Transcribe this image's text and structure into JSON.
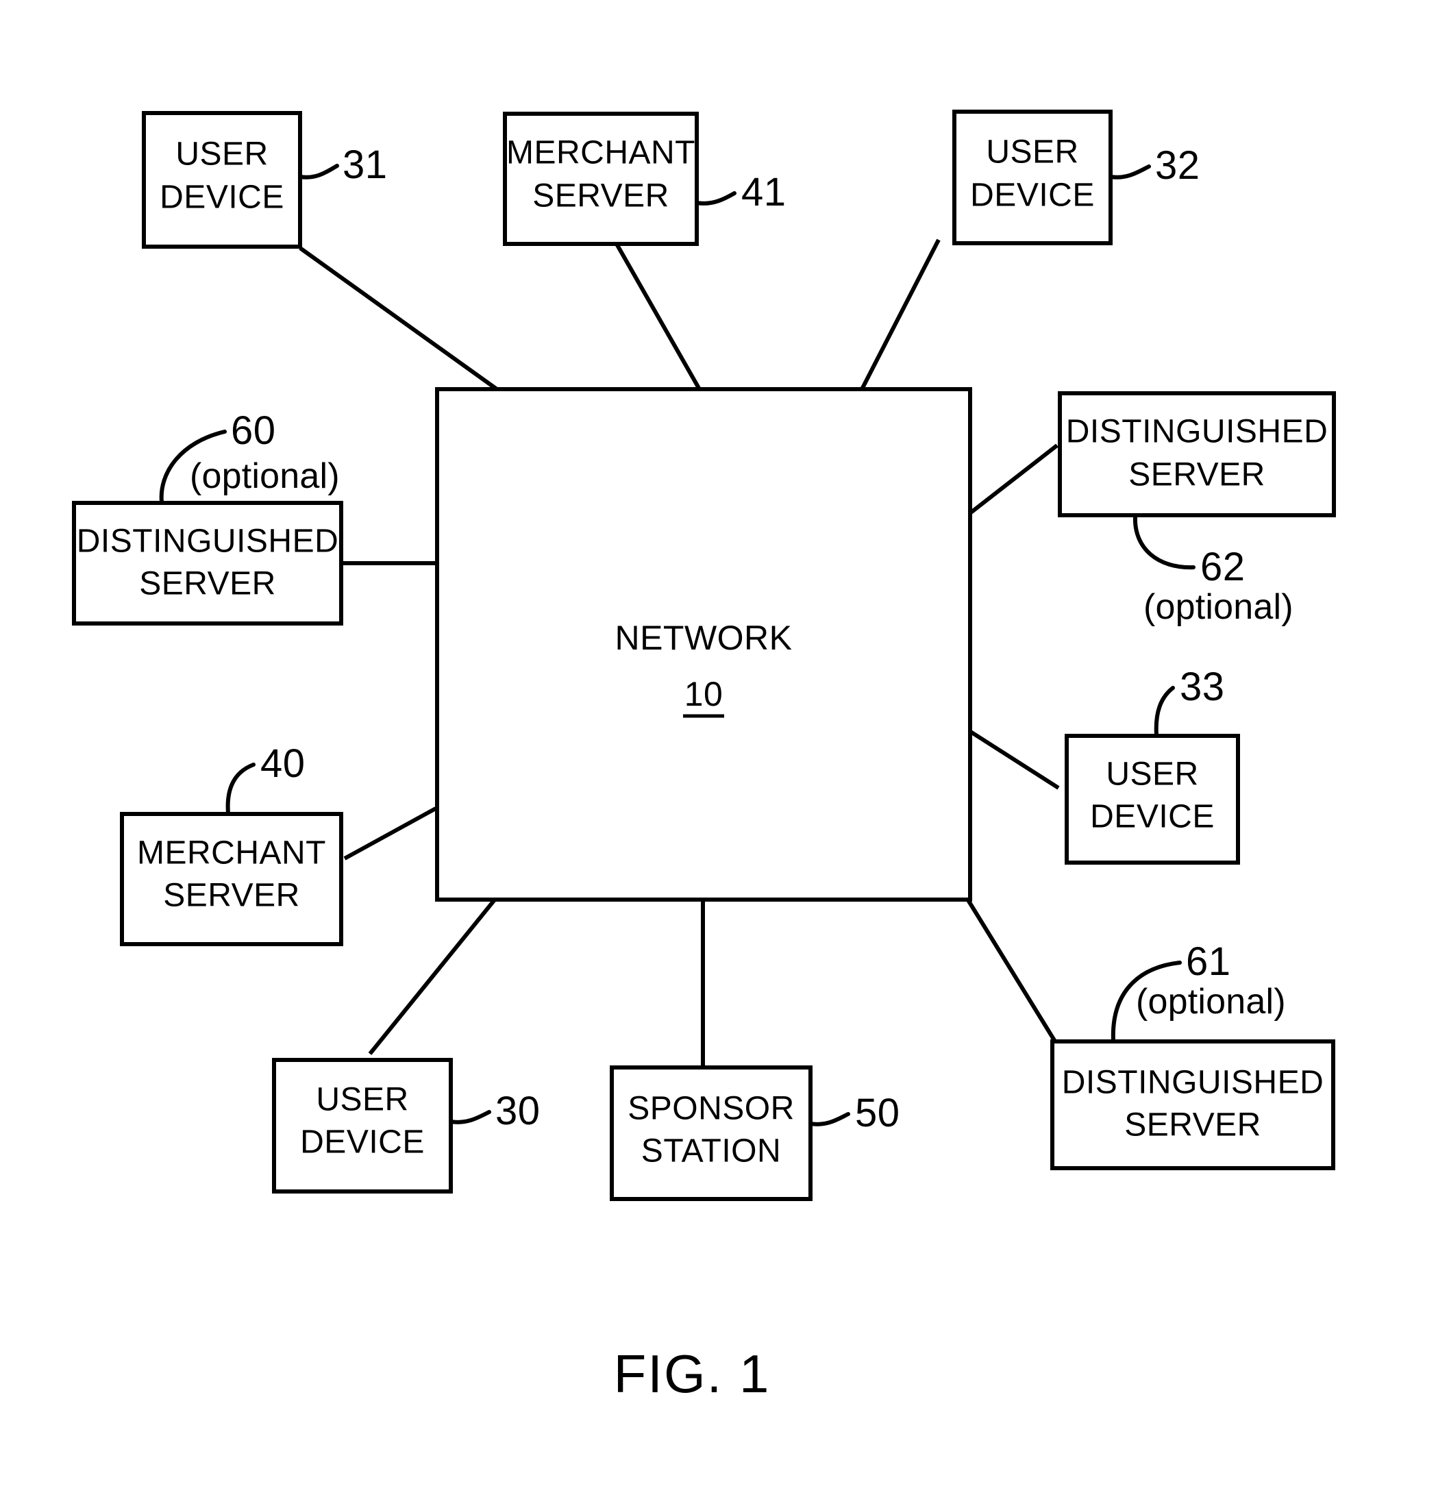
{
  "figure": {
    "caption": "FIG. 1",
    "background_color": "#ffffff",
    "line_color": "#000000"
  },
  "diagram": {
    "type": "block-diagram",
    "hub": {
      "name": "network-hub",
      "label": "NETWORK",
      "reference_number": "10",
      "reference_underlined": true
    },
    "nodes": [
      {
        "id": "user-device-31",
        "line1": "USER",
        "line2": "DEVICE",
        "reference_number": "31",
        "optional_note": "",
        "position": "top-left"
      },
      {
        "id": "merchant-server-41",
        "line1": "MERCHANT",
        "line2": "SERVER",
        "reference_number": "41",
        "optional_note": "",
        "position": "top-center"
      },
      {
        "id": "user-device-32",
        "line1": "USER",
        "line2": "DEVICE",
        "reference_number": "32",
        "optional_note": "",
        "position": "top-right"
      },
      {
        "id": "distinguished-server-60",
        "line1": "DISTINGUISHED",
        "line2": "SERVER",
        "reference_number": "60",
        "optional_note": "(optional)",
        "position": "left-upper"
      },
      {
        "id": "distinguished-server-62",
        "line1": "DISTINGUISHED",
        "line2": "SERVER",
        "reference_number": "62",
        "optional_note": "(optional)",
        "position": "right-upper"
      },
      {
        "id": "user-device-33",
        "line1": "USER",
        "line2": "DEVICE",
        "reference_number": "33",
        "optional_note": "",
        "position": "right-middle"
      },
      {
        "id": "merchant-server-40",
        "line1": "MERCHANT",
        "line2": "SERVER",
        "reference_number": "40",
        "optional_note": "",
        "position": "left-lower"
      },
      {
        "id": "user-device-30",
        "line1": "USER",
        "line2": "DEVICE",
        "reference_number": "30",
        "optional_note": "",
        "position": "bottom-left"
      },
      {
        "id": "sponsor-station-50",
        "line1": "SPONSOR",
        "line2": "STATION",
        "reference_number": "50",
        "optional_note": "",
        "position": "bottom-center"
      },
      {
        "id": "distinguished-server-61",
        "line1": "DISTINGUISHED",
        "line2": "SERVER",
        "reference_number": "61",
        "optional_note": "(optional)",
        "position": "bottom-right"
      }
    ]
  }
}
